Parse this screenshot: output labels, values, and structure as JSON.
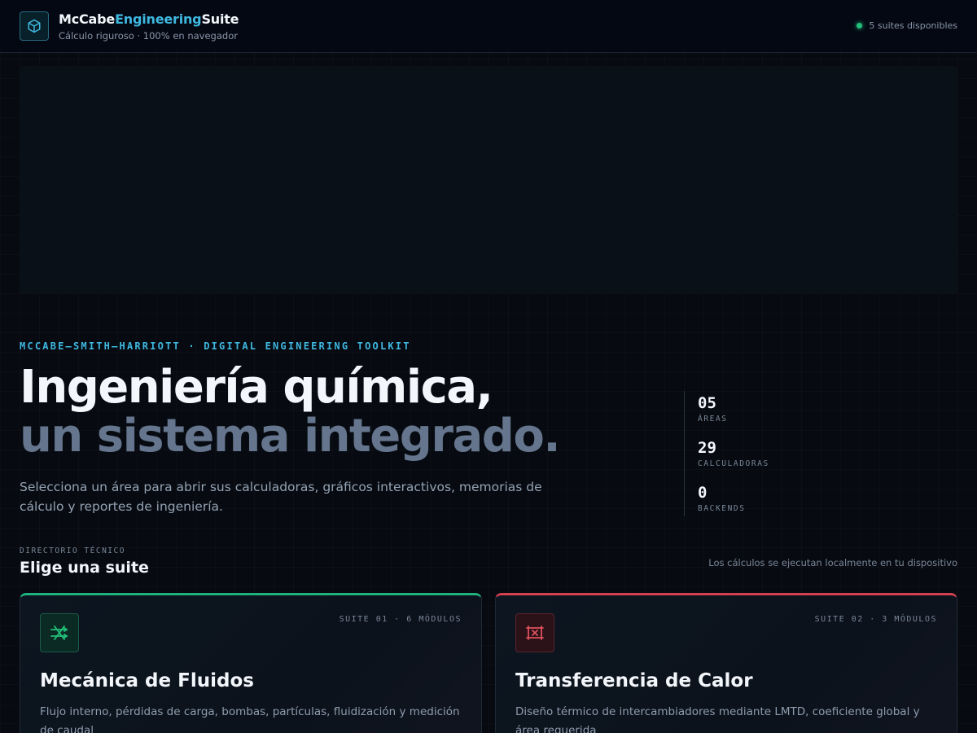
{
  "header": {
    "brand_part1": "McCabe",
    "brand_part2": "Engineering",
    "brand_part3": "Suite",
    "subtitle": "Cálculo riguroso · 100% en navegador",
    "status_text": "5 suites disponibles",
    "logo_icon": "cube-icon"
  },
  "hero": {
    "eyebrow": "MCCABE–SMITH–HARRIOTT · DIGITAL ENGINEERING TOOLKIT",
    "title_line1": "Ingeniería química,",
    "title_line2": "un sistema integrado.",
    "description": "Selecciona un área para abrir sus calculadoras, gráficos interactivos, memorias de cálculo y reportes de ingeniería."
  },
  "stats": [
    {
      "value": "05",
      "label": "ÁREAS"
    },
    {
      "value": "29",
      "label": "CALCULADORAS"
    },
    {
      "value": "0",
      "label": "BACKENDS"
    }
  ],
  "directory": {
    "eyebrow": "DIRECTORIO TÉCNICO",
    "title": "Elige una suite",
    "note": "Los cálculos se ejecutan localmente en tu dispositivo"
  },
  "cards": [
    {
      "meta": "SUITE 01 · 6 MÓDULOS",
      "title": "Mecánica de Fluidos",
      "description": "Flujo interno, pérdidas de carga, bombas, partículas, fluidización y medición de caudal",
      "icon": "fluid-flow-icon",
      "accent": "#1fb27c"
    },
    {
      "meta": "SUITE 02 · 3 MÓDULOS",
      "title": "Transferencia de Calor",
      "description": "Diseño térmico de intercambiadores mediante LMTD, coeficiente global y área requerida",
      "icon": "heat-exchanger-icon",
      "accent": "#d6404f"
    }
  ],
  "colors": {
    "primary_accent": "#3fb8e0",
    "status_online": "#22c07a"
  }
}
